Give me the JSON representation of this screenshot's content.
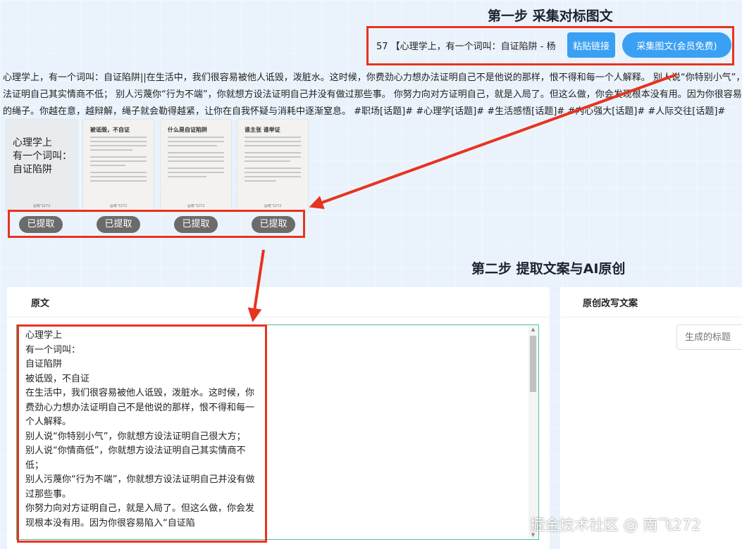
{
  "step1": {
    "title": "第一步 采集对标图文"
  },
  "url_input": {
    "value": "57 【心理学上，有一个词叫：自证陷阱 - 杨"
  },
  "buttons": {
    "paste": "粘贴链接",
    "collect": "采集图文(会员免费)"
  },
  "desc_lines": [
    "心理学上，有一个词叫：自证陷阱||在生活中，我们很容易被他人诋毁，泼脏水。这时候，你费劲心力想办法证明自己不是他说的那样，恨不得和每一个人解释。 别人说“你特别小气”，你",
    "法证明自己其实情商不低；  别人污蔑你“行为不端”，你就想方设法证明自己并没有做过那些事。 你努力向对方证明自己，就是入局了。但这么做，你会发现根本没有用。因为你很容易陷入",
    "的绳子。你越在意，越辩解，绳子就会勒得越紧，让你在自我怀疑与消耗中逐渐窒息。 #职场[话题]#  #心理学[话题]#  #生活感悟[话题]#  #内心强大[话题]#  #人际交往[话题]#"
  ],
  "cards": [
    {
      "title_lines": [
        "心理学上",
        "有一个词叫：",
        "自证陷阱"
      ],
      "footer": "@南飞272"
    },
    {
      "title": "被诋毁，不自证",
      "footer": "@南飞272"
    },
    {
      "title": "什么是自证陷阱",
      "footer": "@南飞272"
    },
    {
      "title": "谁主张 谁举证",
      "footer": "@南飞272"
    }
  ],
  "tags": [
    "已提取",
    "已提取",
    "已提取",
    "已提取"
  ],
  "step2": {
    "title": "第二步 提取文案与AI原创"
  },
  "original": {
    "header": "原文",
    "lines": [
      "心理学上",
      "有一个词叫：",
      "自证陷阱",
      "被诋毁，不自证",
      "在生活中，我们很容易被他人诋毁，泼脏水。这时候，你费劲心力想办法证明自己不是他说的那样，恨不得和每一个人解释。",
      "别人说“你特别小气”，你就想方设法证明自己很大方；",
      "别人说“你情商低”，你就想方设法证明自己其实情商不低；",
      "别人污蔑你“行为不端”，你就想方设法证明自己并没有做过那些事。",
      "你努力向对方证明自己，就是入局了。但这么做，你会发现根本没有用。因为你很容易陷入“自证陷"
    ]
  },
  "rewrite": {
    "header": "原创改写文案",
    "title_placeholder": "生成的标题"
  },
  "watermark": "掘金技术社区 @ 南飞272",
  "colors": {
    "accent_blue": "#3aa0f3",
    "highlight_red": "#e8331f",
    "tag_gray": "#6b6b6b",
    "focus_green": "#45c48b"
  }
}
